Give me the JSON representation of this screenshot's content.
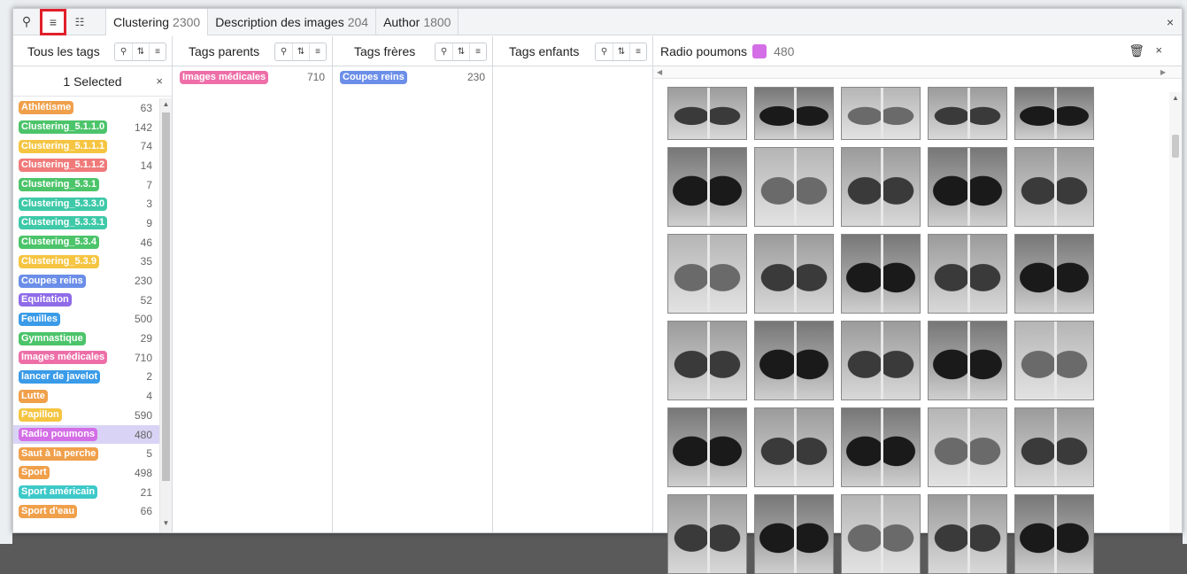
{
  "toolbar": {
    "tag_icon": "tag-icon",
    "list_icon": "list-icon",
    "tree_icon": "tree-icon",
    "close": "×"
  },
  "tabs": [
    {
      "label": "Clustering",
      "count": "2300"
    },
    {
      "label": "Description des images",
      "count": "204"
    },
    {
      "label": "Author",
      "count": "1800"
    }
  ],
  "columns": {
    "all_tags": {
      "title": "Tous les tags",
      "selected_label": "1 Selected",
      "clear": "×"
    },
    "parents": {
      "title": "Tags parents"
    },
    "siblings": {
      "title": "Tags frères"
    },
    "children": {
      "title": "Tags enfants"
    }
  },
  "tags": [
    {
      "label": "Athlétisme",
      "count": "63",
      "color": "#f0a04b"
    },
    {
      "label": "Clustering_5.1.1.0",
      "count": "142",
      "color": "#4cc46a"
    },
    {
      "label": "Clustering_5.1.1.1",
      "count": "74",
      "color": "#f5c542"
    },
    {
      "label": "Clustering_5.1.1.2",
      "count": "14",
      "color": "#f07a7a"
    },
    {
      "label": "Clustering_5.3.1",
      "count": "7",
      "color": "#4cc46a"
    },
    {
      "label": "Clustering_5.3.3.0",
      "count": "3",
      "color": "#3ec9a8"
    },
    {
      "label": "Clustering_5.3.3.1",
      "count": "9",
      "color": "#3ec9a8"
    },
    {
      "label": "Clustering_5.3.4",
      "count": "46",
      "color": "#4cc46a"
    },
    {
      "label": "Clustering_5.3.9",
      "count": "35",
      "color": "#f5c542"
    },
    {
      "label": "Coupes reins",
      "count": "230",
      "color": "#6b8ee8"
    },
    {
      "label": "Equitation",
      "count": "52",
      "color": "#8f6be8"
    },
    {
      "label": "Feuilles",
      "count": "500",
      "color": "#3a9be8"
    },
    {
      "label": "Gymnastique",
      "count": "29",
      "color": "#4cc46a"
    },
    {
      "label": "Images médicales",
      "count": "710",
      "color": "#ee6fa8"
    },
    {
      "label": "lancer de javelot",
      "count": "2",
      "color": "#3a9be8"
    },
    {
      "label": "Lutte",
      "count": "4",
      "color": "#f0a04b"
    },
    {
      "label": "Papillon",
      "count": "590",
      "color": "#f5c542"
    },
    {
      "label": "Radio poumons",
      "count": "480",
      "color": "#d46ee6"
    },
    {
      "label": "Saut à la perche",
      "count": "5",
      "color": "#f0a04b"
    },
    {
      "label": "Sport",
      "count": "498",
      "color": "#f0a04b"
    },
    {
      "label": "Sport américain",
      "count": "21",
      "color": "#3ec9c9"
    },
    {
      "label": "Sport d'eau",
      "count": "66",
      "color": "#f0a04b"
    }
  ],
  "selected_tag": "Radio poumons",
  "parents_list": [
    {
      "label": "Images médicales",
      "count": "710",
      "color": "#ee6fa8"
    }
  ],
  "siblings_list": [
    {
      "label": "Coupes reins",
      "count": "230",
      "color": "#6b8ee8"
    }
  ],
  "image_panel": {
    "title": "Radio poumons",
    "count": "480",
    "swatch_color": "#d46ee6",
    "trash_icon": "trash-icon",
    "close": "×"
  }
}
